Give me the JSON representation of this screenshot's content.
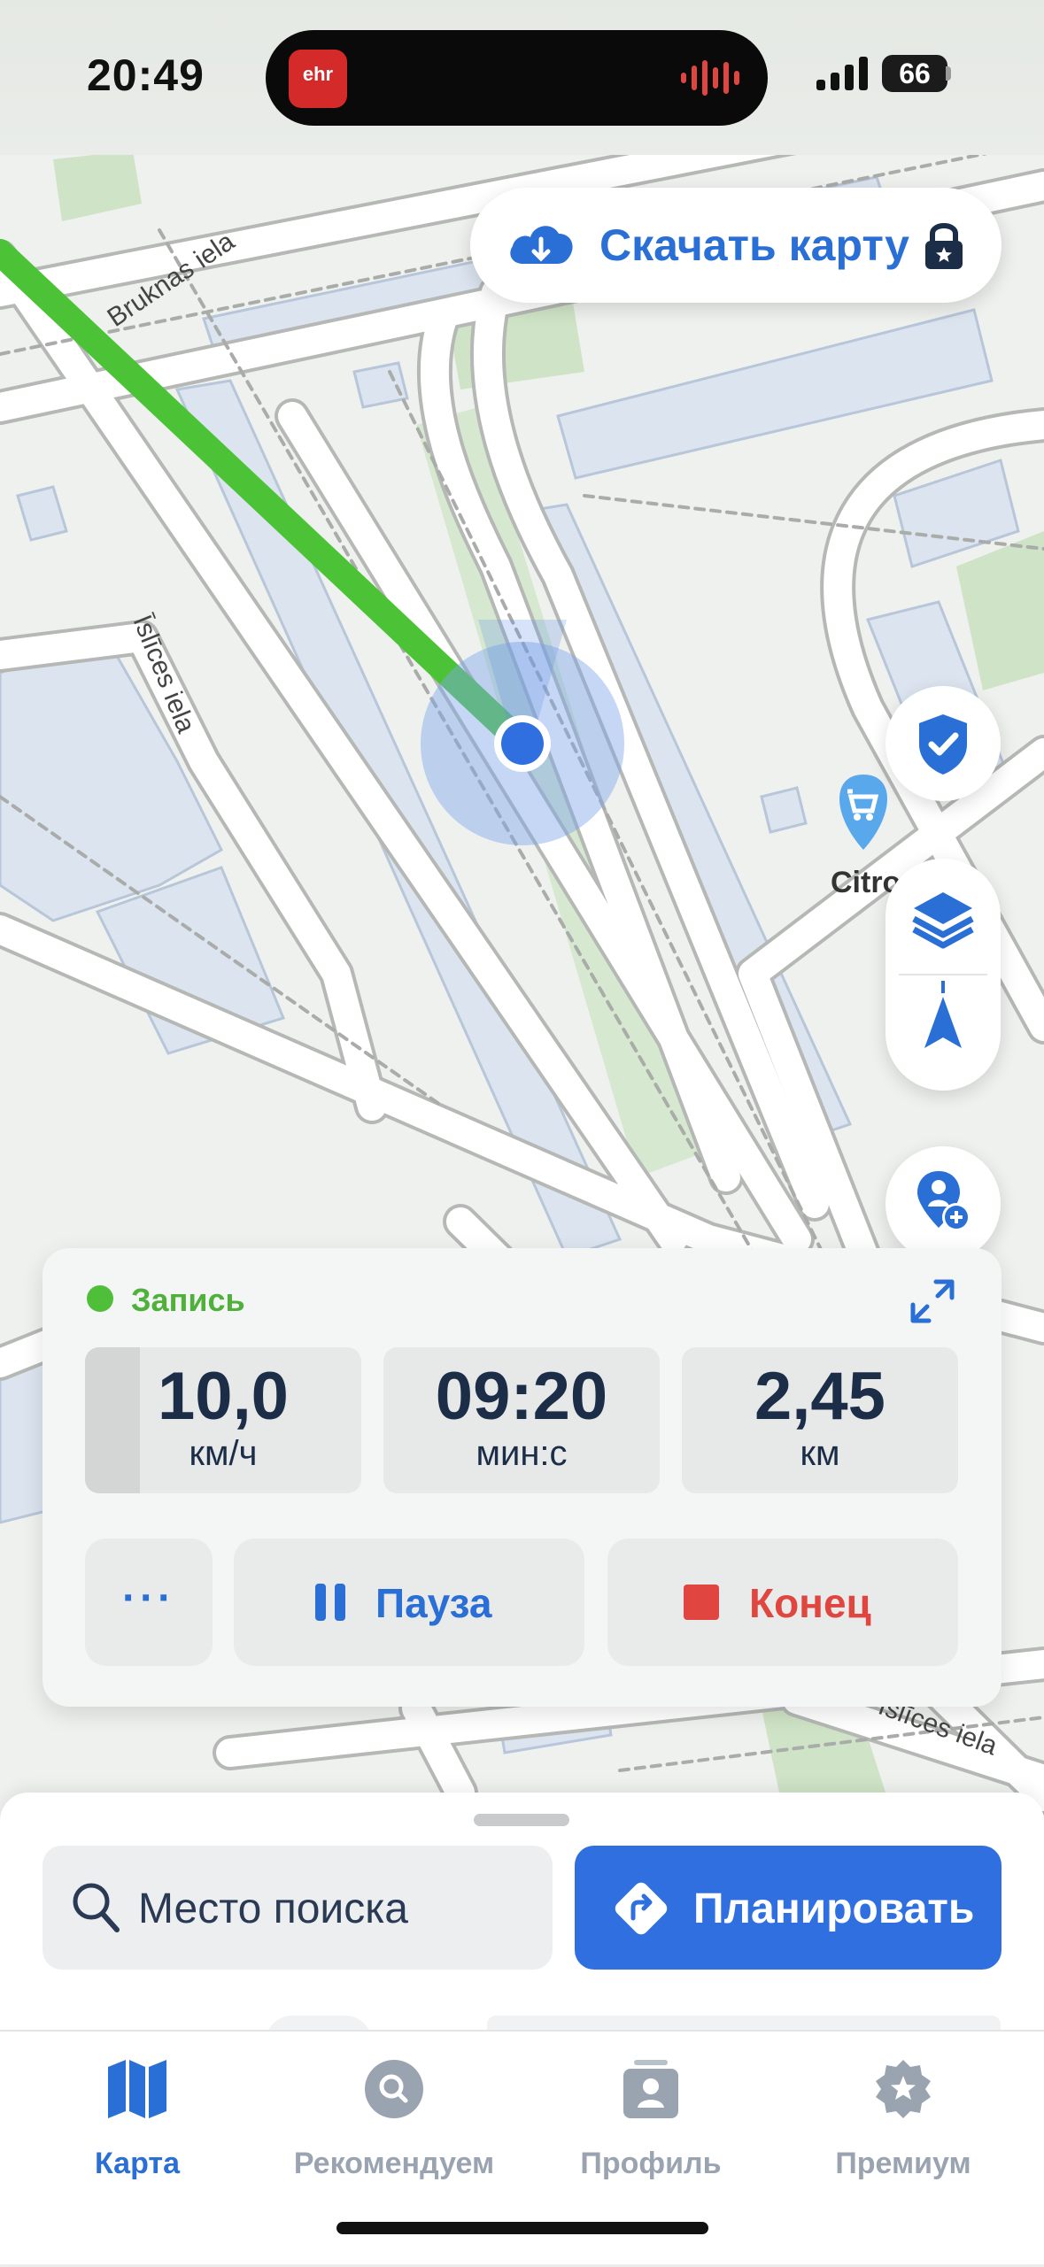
{
  "status_bar": {
    "time": "20:49",
    "dynamic_island_app": "ehr",
    "battery": "66"
  },
  "map": {
    "street_labels": [
      "Bruknas iela",
      "Īslīces iela",
      "Īslīces iela"
    ],
    "poi_label": "Citro",
    "download_button": "Скачать карту"
  },
  "recording": {
    "status": "Запись",
    "speed_value": "10,0",
    "speed_unit": "км/ч",
    "speed_fill_fraction": 0.2,
    "time_value": "09:20",
    "time_unit": "мин:с",
    "distance_value": "2,45",
    "distance_unit": "км",
    "more_label": "···",
    "pause_label": "Пауза",
    "end_label": "Конец"
  },
  "sheet": {
    "search_placeholder": "Место поиска",
    "plan_label": "Планировать"
  },
  "tabs": [
    {
      "label": "Карта",
      "icon": "map-icon",
      "active": true
    },
    {
      "label": "Рекомендуем",
      "icon": "search-icon",
      "active": false
    },
    {
      "label": "Профиль",
      "icon": "profile-icon",
      "active": false
    },
    {
      "label": "Премиум",
      "icon": "premium-star-icon",
      "active": false
    }
  ],
  "colors": {
    "accent": "#2a6fd6",
    "route": "#4cc337",
    "recording": "#4fbf3a",
    "end": "#e0463f"
  }
}
